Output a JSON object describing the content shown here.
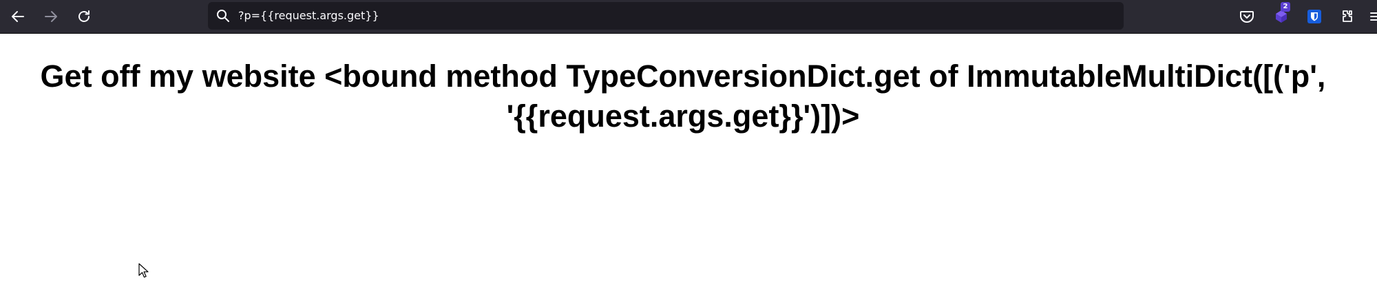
{
  "browser": {
    "url": "?p={{request.args.get}}",
    "toolbar_icons": {
      "back": "arrow-left-icon",
      "forward": "arrow-right-icon",
      "reload": "reload-icon",
      "search": "search-icon",
      "pocket": "pocket-icon",
      "extension": "extension-icon",
      "bitwarden": "bitwarden-shield-icon",
      "extensions_menu": "puzzle-icon"
    },
    "extension_badge": "2",
    "colors": {
      "toolbar_bg": "#2b2a33",
      "urlbar_bg": "#1c1b22",
      "icon_color": "#fbfbfe",
      "badge_bg": "#5b3fd0",
      "bitwarden_blue": "#175ddc"
    }
  },
  "page": {
    "heading_line1": "Get off my website <bound method TypeConversionDict.get of ImmutableMultiDict([('p',",
    "heading_line2": "'{{request.args.get}}')])>"
  }
}
